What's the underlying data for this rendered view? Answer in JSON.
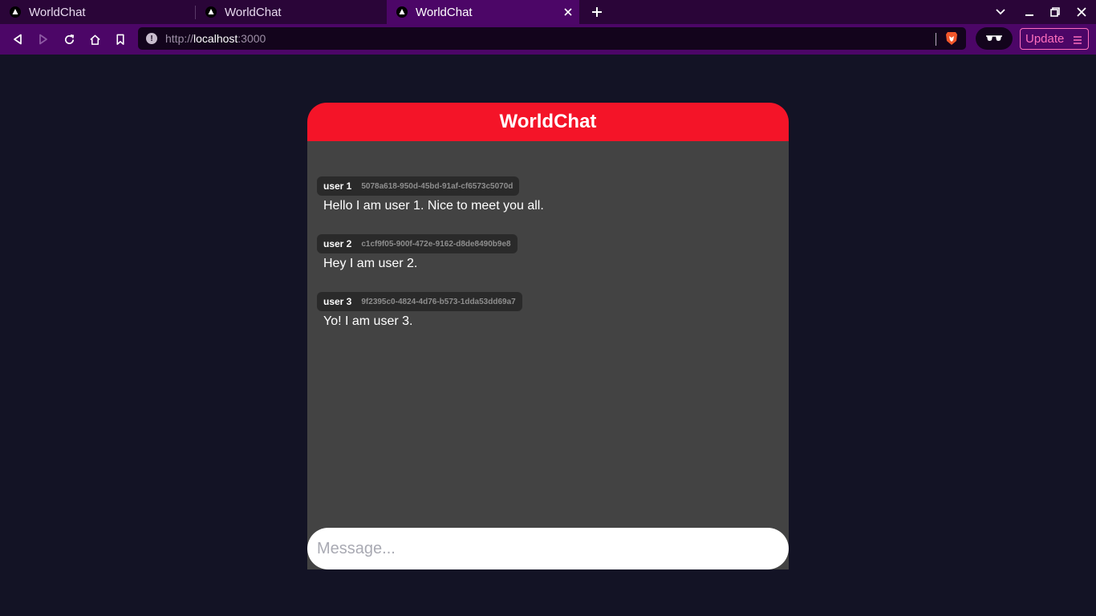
{
  "browser": {
    "tabs": [
      {
        "title": "WorldChat",
        "active": false
      },
      {
        "title": "WorldChat",
        "active": false
      },
      {
        "title": "WorldChat",
        "active": true
      }
    ],
    "url_scheme": "http://",
    "url_host": "localhost",
    "url_port": ":3000",
    "update_label": "Update",
    "colors": {
      "tabstrip": "#2a0538",
      "toolbar": "#4c0667",
      "update_accent": "#ff6fbd"
    }
  },
  "chat": {
    "title": "WorldChat",
    "messages": [
      {
        "user": "user 1",
        "id": "5078a618-950d-45bd-91af-cf6573c5070d",
        "text": "Hello I am user 1. Nice to meet you all."
      },
      {
        "user": "user 2",
        "id": "c1cf9f05-900f-472e-9162-d8de8490b9e8",
        "text": "Hey I am user 2."
      },
      {
        "user": "user 3",
        "id": "9f2395c0-4824-4d76-b573-1dda53dd69a7",
        "text": "Yo! I am user 3."
      }
    ],
    "input_placeholder": "Message...",
    "colors": {
      "header": "#f41428",
      "body": "#434343",
      "page_bg": "#131325"
    }
  }
}
